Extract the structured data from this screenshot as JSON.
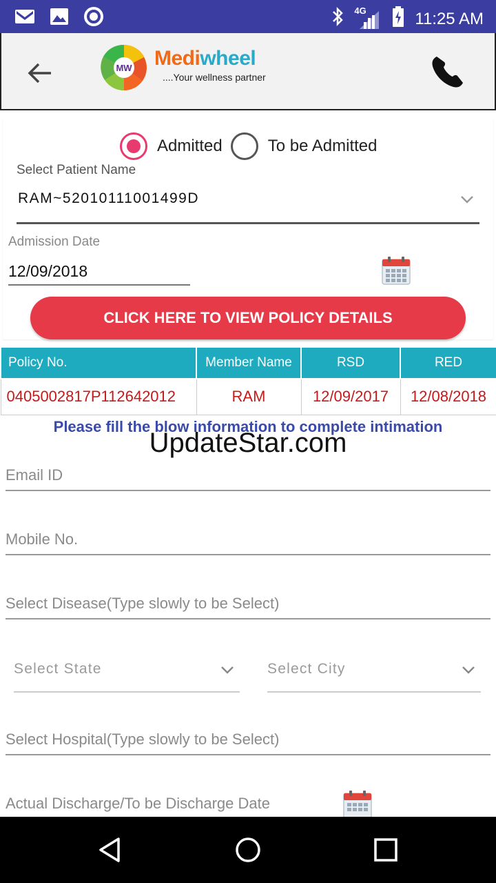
{
  "status_bar": {
    "time": "11:25 AM",
    "network": "4G",
    "icons": [
      "gmail-icon",
      "gallery-icon",
      "record-icon",
      "bluetooth-icon",
      "signal-icon",
      "battery-icon"
    ]
  },
  "header": {
    "brand_part1": "Medi",
    "brand_part2": "wheel",
    "tagline": "....Your wellness partner",
    "logo_text": "MW"
  },
  "admission_type": {
    "options": [
      {
        "label": "Admitted",
        "selected": true
      },
      {
        "label": "To be Admitted",
        "selected": false
      }
    ]
  },
  "patient": {
    "label": "Select Patient Name",
    "value": "RAM~52010111001499D"
  },
  "admission_date": {
    "label": "Admission Date",
    "value": "12/09/2018"
  },
  "policy_button_label": "CLICK HERE TO VIEW POLICY DETAILS",
  "policy_table": {
    "headers": [
      "Policy No.",
      "Member Name",
      "RSD",
      "RED"
    ],
    "rows": [
      [
        "0405002817P112642012",
        "RAM",
        "12/09/2017",
        "12/08/2018"
      ]
    ]
  },
  "notice": "Please fill the blow information to complete intimation",
  "watermark": "UpdateStar.com",
  "form": {
    "email_placeholder": "Email ID",
    "mobile_placeholder": "Mobile No.",
    "disease_placeholder": "Select Disease(Type slowly to be Select)",
    "state_placeholder": "Select State",
    "city_placeholder": "Select City",
    "hospital_placeholder": "Select Hospital(Type slowly to be Select)",
    "discharge_label": "Actual Discharge/To be Discharge Date"
  },
  "colors": {
    "status_bar": "#3b3ea0",
    "accent_pink": "#e83a6e",
    "button_red": "#e63a48",
    "table_header": "#1eaabf",
    "table_text": "#c41a1a",
    "notice_text": "#3a4aa8"
  }
}
